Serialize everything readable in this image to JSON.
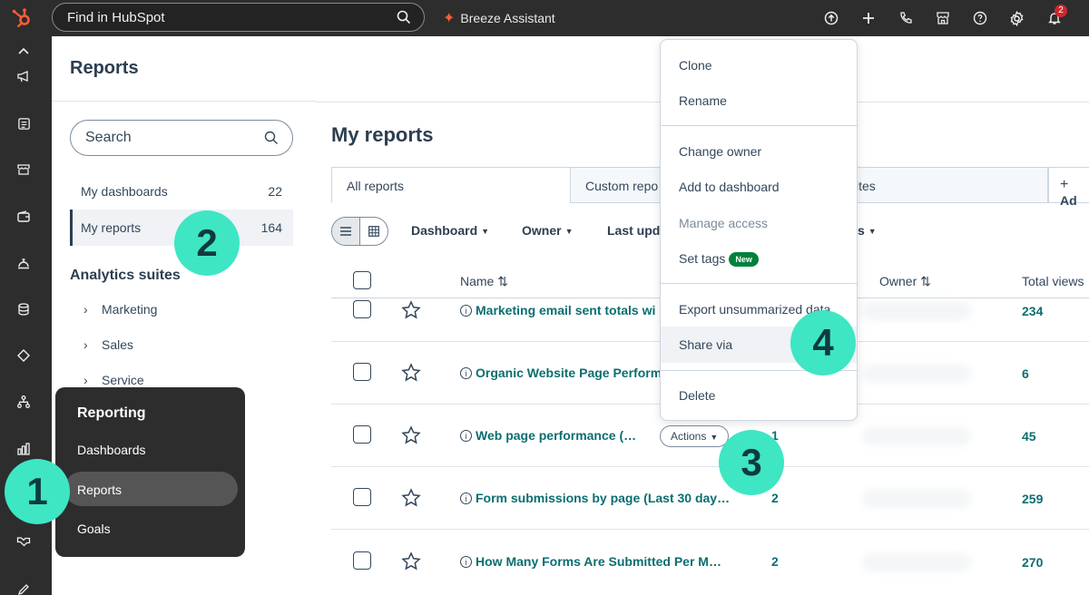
{
  "topbar": {
    "search_placeholder": "Find in HubSpot",
    "breeze_label": "Breeze Assistant",
    "notification_count": "2"
  },
  "page": {
    "title": "Reports"
  },
  "sidebar": {
    "search_placeholder": "Search",
    "items": [
      {
        "label": "My dashboards",
        "count": "22"
      },
      {
        "label": "My reports",
        "count": "164"
      }
    ],
    "suites_title": "Analytics suites",
    "suites": [
      "Marketing",
      "Sales",
      "Service"
    ]
  },
  "reporting_menu": {
    "title": "Reporting",
    "items": [
      "Dashboards",
      "Reports",
      "Goals"
    ]
  },
  "main": {
    "title": "My reports",
    "tabs": [
      "All reports",
      "Custom repo",
      "ites"
    ],
    "add_tab_label": "Ad",
    "filters": [
      "Dashboard",
      "Owner",
      "Last upd",
      "s"
    ],
    "columns": {
      "name": "Name",
      "owner": "Owner",
      "views": "Total views"
    },
    "rows": [
      {
        "name": "Marketing email sent totals wi",
        "dashboards": "",
        "views": "234"
      },
      {
        "name": "Organic Website Page Perform",
        "dashboards": "",
        "views": "6"
      },
      {
        "name": "Web page performance (…",
        "dashboards": "1",
        "views": "45"
      },
      {
        "name": "Form submissions by page (Last 30 day…",
        "dashboards": "2",
        "views": "259"
      },
      {
        "name": "How Many Forms Are Submitted Per M…",
        "dashboards": "2",
        "views": "270"
      }
    ],
    "actions_label": "Actions"
  },
  "actions_menu": {
    "items": [
      "Clone",
      "Rename",
      "Change owner",
      "Add to dashboard",
      "Manage access",
      "Set tags",
      "Export unsummarized data",
      "Share via",
      "Delete"
    ],
    "new_badge": "New"
  },
  "steps": [
    "1",
    "2",
    "3",
    "4"
  ],
  "colors": {
    "accent": "#3ee6c4",
    "link": "#0b6e70",
    "brand": "#ff5c35",
    "dark": "#2d2d2d"
  }
}
